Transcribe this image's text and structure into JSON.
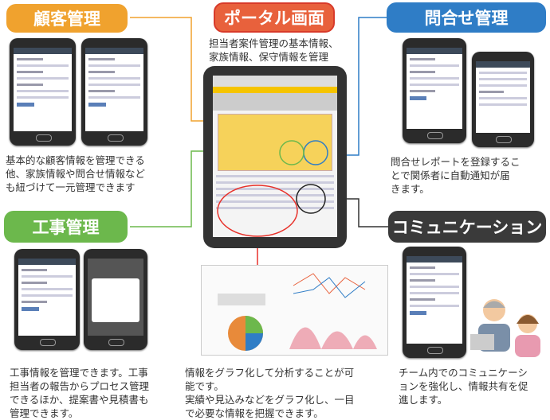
{
  "sections": {
    "customer": {
      "title": "顧客管理",
      "color": "#f0a22e",
      "desc": [
        "基本的な顧客情報を管理できる",
        "他、家族情報や問合せ情報など",
        "も紐づけて一元管理できます"
      ]
    },
    "construction": {
      "title": "工事管理",
      "color": "#6cb84c",
      "desc": [
        "工事情報を管理できます。工事",
        "担当者の報告からプロセス管理",
        "できるほか、提案書や見積書も",
        "管理できます。"
      ]
    },
    "portal": {
      "title": "ポータル画面",
      "color": "#e8613c",
      "subtitle": [
        "担当者案件管理の基本情報、",
        "家族情報、保守情報を管理"
      ],
      "desc": [
        "情報をグラフ化して分析することが可",
        "能です。",
        "実績や見込みなどをグラフ化し、一目",
        "で必要な情報を把握できます。"
      ]
    },
    "inquiry": {
      "title": "問合せ管理",
      "color": "#2f7dc6",
      "desc": [
        "問合せレポートを登録するこ",
        "とで関係者に自動通知が届",
        "きます。"
      ]
    },
    "communication": {
      "title": "コミュニケーション",
      "color": "#3a3a3a",
      "desc": [
        "チーム内でのコミュニケーシ",
        "ョンを強化し、情報共有を促",
        "進します。"
      ]
    }
  }
}
